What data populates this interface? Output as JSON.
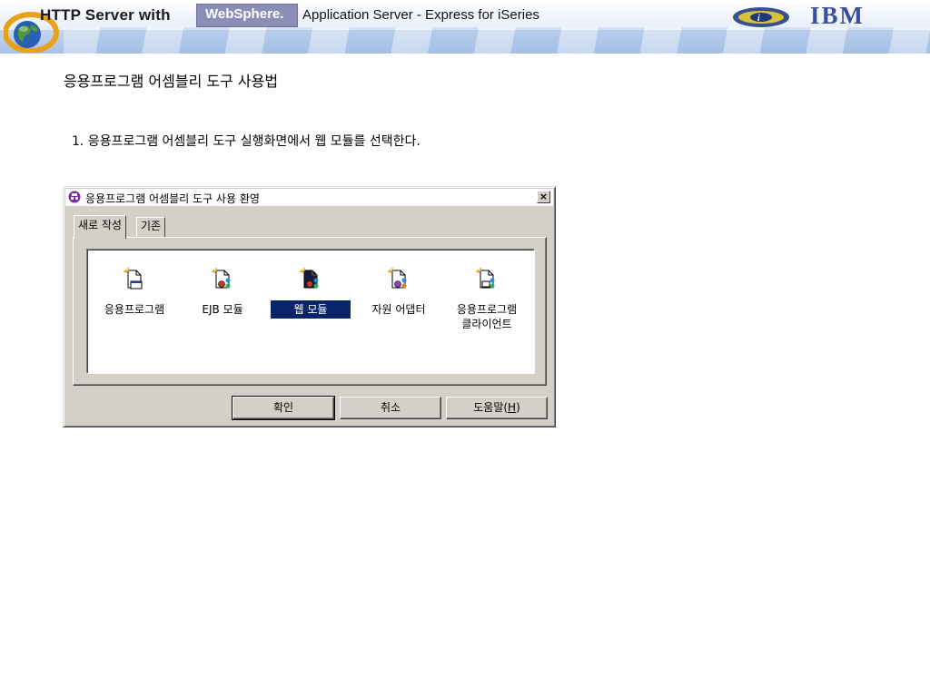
{
  "banner": {
    "title": "HTTP Server with",
    "brand": "WebSphere.",
    "subtitle": "Application Server - Express for iSeries",
    "logo_text": "IBM"
  },
  "page": {
    "title": "응용프로그램 어셈블리 도구 사용법",
    "step": "1. 응용프로그램 어셈블리 도구 실행화면에서 웹 모듈를 선택한다."
  },
  "dialog": {
    "title": "응용프로그램 어셈블리 도구 사용 환영",
    "close_label": "×",
    "tabs": [
      {
        "label": "새로 작성",
        "active": true
      },
      {
        "label": "기존",
        "active": false
      }
    ],
    "items": [
      {
        "label": "응용프로그램",
        "icon": "application-icon"
      },
      {
        "label": "EJB 모듈",
        "icon": "ejb-module-icon"
      },
      {
        "label": "웹 모듈",
        "icon": "web-module-icon",
        "selected": true
      },
      {
        "label": "자원 어댑터",
        "icon": "resource-adapter-icon"
      },
      {
        "label": "응용프로그램 클라이언트",
        "icon": "application-client-icon"
      }
    ],
    "buttons": {
      "ok": "확인",
      "cancel": "취소",
      "help": "도움말(",
      "help_key": "H",
      "help_end": ")"
    },
    "colors": {
      "selection": "#0a246a",
      "face": "#d4d0c8"
    }
  }
}
